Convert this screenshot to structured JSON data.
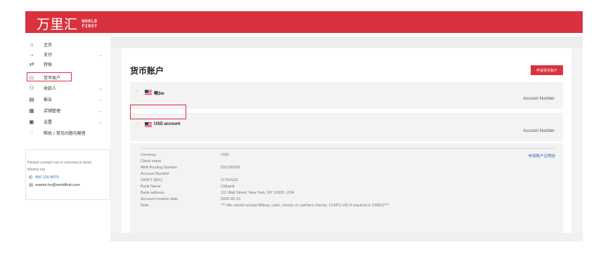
{
  "header": {
    "logo_cn": "万里汇",
    "logo_en_line1": "WORLD",
    "logo_en_line2": "FIRST"
  },
  "sidebar": {
    "items": [
      {
        "label": "主页",
        "icon": "home-icon",
        "glyph": "⌂",
        "chevron": false
      },
      {
        "label": "支付",
        "icon": "arrow-right-icon",
        "glyph": "→",
        "chevron": true
      },
      {
        "label": "转账",
        "icon": "transfer-icon",
        "glyph": "⇄",
        "chevron": false
      },
      {
        "label": "货币账户",
        "icon": "wallet-icon",
        "glyph": "▭",
        "chevron": false
      },
      {
        "label": "收款人",
        "icon": "users-icon",
        "glyph": "⚇",
        "chevron": true
      },
      {
        "label": "报告",
        "icon": "report-icon",
        "glyph": "▤",
        "chevron": true
      },
      {
        "label": "店铺管理",
        "icon": "store-icon",
        "glyph": "▦",
        "chevron": true
      },
      {
        "label": "设置",
        "icon": "settings-icon",
        "glyph": "▣",
        "chevron": true
      },
      {
        "label": "帮助 / 常见问题与解答",
        "icon": "help-icon",
        "glyph": "◌",
        "chevron": false
      }
    ],
    "chevron_glyph": "⌄"
  },
  "contact": {
    "line1": "Please contact our e-commerce desk:",
    "name": "Mamie Ho",
    "phone": "400 120 9075",
    "email": "mamie.ho@worldfirst.com"
  },
  "main": {
    "title": "货币账户",
    "apply_button": "申请货币账户",
    "accounts": [
      {
        "name": "啊3m",
        "number_label": "Account Number",
        "expanded": false,
        "chevron": "›"
      },
      {
        "name": "USD account",
        "number_label": "Account Number",
        "expanded": true,
        "chevron": "⌄"
      }
    ],
    "details": {
      "link": "申请账户证明信",
      "rows": [
        {
          "label": "Currency",
          "value": "USD"
        },
        {
          "label": "Client name",
          "value": ""
        },
        {
          "label": "ABA Routing Number",
          "value": "031100209"
        },
        {
          "label": "Account Number",
          "value": ""
        },
        {
          "label": "SWIFT (BIC)",
          "value": "CITIUS33"
        },
        {
          "label": "Bank Name",
          "value": "Citibank"
        },
        {
          "label": "Bank address",
          "value": "111 Wall Street, New York, NY 10005, USA"
        },
        {
          "label": "Account creation date",
          "value": "2020-05-15"
        },
        {
          "label": "Note",
          "value": "*** We cannot accept Billpay, cash, checks or cashiers checks. CHIPS UID if required is 239822***"
        }
      ]
    }
  },
  "colors": {
    "brand_red": "#d9323f",
    "link_blue": "#2a6db8"
  }
}
